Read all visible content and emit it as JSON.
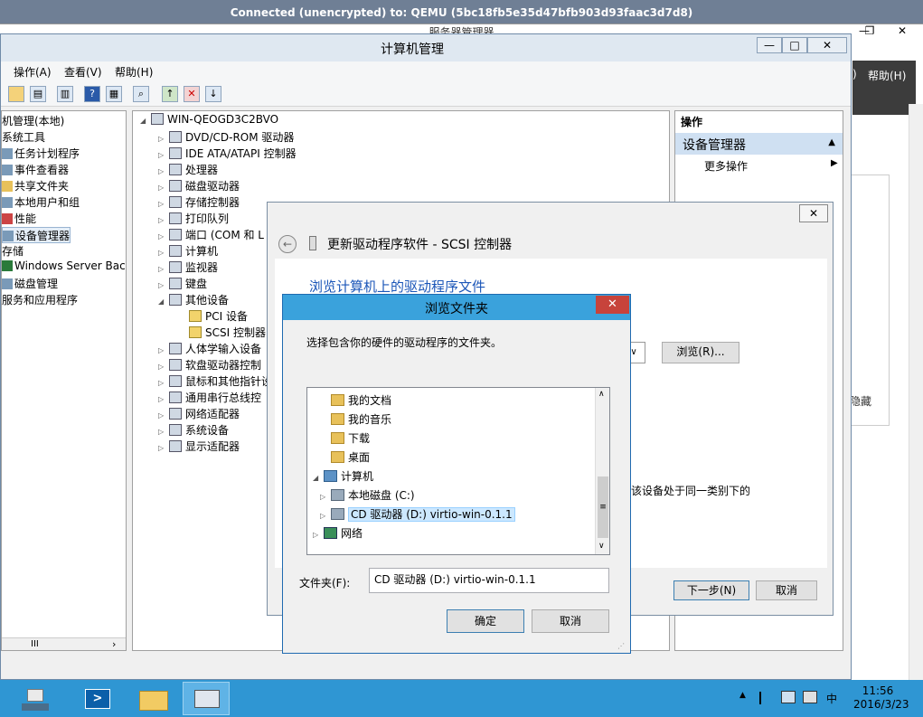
{
  "vnc": {
    "title": "Connected (unencrypted) to: QEMU (5bc18fb5e35d47bfb903d93faac3d7d8)"
  },
  "server_manager": {
    "title": "服务器管理器",
    "help_menu": "帮助(H)",
    "paren": ")",
    "hide_label": "隐藏",
    "controls": {
      "min": "—",
      "max": "❐",
      "close": "✕"
    }
  },
  "computer_mgmt": {
    "title": "计算机管理",
    "controls": {
      "min": "—",
      "max": "□",
      "close": "✕"
    },
    "menu": [
      "操作(A)",
      "查看(V)",
      "帮助(H)"
    ],
    "toolbar_icons": [
      "back-icon",
      "up-folder-icon",
      "properties-icon",
      "export-icon",
      "help-icon",
      "panel-icon",
      "scan-icon",
      "update-driver-icon",
      "disable-device-icon",
      "uninstall-icon"
    ],
    "left_tree": [
      {
        "label": "机管理(本地)",
        "indent": 0
      },
      {
        "label": "系统工具",
        "indent": 0
      },
      {
        "label": "任务计划程序",
        "indent": 1
      },
      {
        "label": "事件查看器",
        "indent": 1
      },
      {
        "label": "共享文件夹",
        "indent": 1
      },
      {
        "label": "本地用户和组",
        "indent": 1
      },
      {
        "label": "性能",
        "indent": 1
      },
      {
        "label": "设备管理器",
        "indent": 1
      },
      {
        "label": "存储",
        "indent": 0
      },
      {
        "label": "Windows Server Back",
        "indent": 1
      },
      {
        "label": "磁盘管理",
        "indent": 1
      },
      {
        "label": "服务和应用程序",
        "indent": 0
      }
    ],
    "left_scroll_label": "III",
    "device_root": "WIN-QEOGD3C2BVO",
    "devices": [
      {
        "label": "DVD/CD-ROM 驱动器",
        "expanded": false,
        "indent": 1
      },
      {
        "label": "IDE ATA/ATAPI 控制器",
        "expanded": false,
        "indent": 1
      },
      {
        "label": "处理器",
        "expanded": false,
        "indent": 1
      },
      {
        "label": "磁盘驱动器",
        "expanded": false,
        "indent": 1
      },
      {
        "label": "存储控制器",
        "expanded": false,
        "indent": 1
      },
      {
        "label": "打印队列",
        "expanded": false,
        "indent": 1
      },
      {
        "label": "端口 (COM 和 L",
        "expanded": false,
        "indent": 1
      },
      {
        "label": "计算机",
        "expanded": false,
        "indent": 1
      },
      {
        "label": "监视器",
        "expanded": false,
        "indent": 1
      },
      {
        "label": "键盘",
        "expanded": false,
        "indent": 1
      },
      {
        "label": "其他设备",
        "expanded": true,
        "indent": 1
      },
      {
        "label": "PCI 设备",
        "expanded": null,
        "indent": 2,
        "warning": true
      },
      {
        "label": "SCSI 控制器",
        "expanded": null,
        "indent": 2,
        "warning": true
      },
      {
        "label": "人体学输入设备",
        "expanded": false,
        "indent": 1
      },
      {
        "label": "软盘驱动器控制",
        "expanded": false,
        "indent": 1
      },
      {
        "label": "鼠标和其他指针设",
        "expanded": false,
        "indent": 1
      },
      {
        "label": "通用串行总线控",
        "expanded": false,
        "indent": 1
      },
      {
        "label": "网络适配器",
        "expanded": false,
        "indent": 1
      },
      {
        "label": "系统设备",
        "expanded": false,
        "indent": 1
      },
      {
        "label": "显示适配器",
        "expanded": false,
        "indent": 1
      }
    ],
    "actions": {
      "header": "操作",
      "section": "设备管理器",
      "more": "更多操作"
    }
  },
  "wizard": {
    "title": "更新驱动程序软件 - SCSI 控制器",
    "heading": "浏览计算机上的驱动程序文件",
    "browse_btn": "浏览(R)...",
    "partial_text": "该设备处于同一类别下的",
    "next_btn": "下一步(N)",
    "cancel_btn": "取消",
    "close": "✕"
  },
  "browse_dialog": {
    "title": "浏览文件夹",
    "close": "✕",
    "instruction": "选择包含你的硬件的驱动程序的文件夹。",
    "tree": [
      {
        "label": "我的文档",
        "icon": "folder-icon",
        "indent": 2,
        "selected": false,
        "arrow": ""
      },
      {
        "label": "我的音乐",
        "icon": "folder-icon",
        "indent": 2,
        "selected": false,
        "arrow": ""
      },
      {
        "label": "下载",
        "icon": "folder-icon",
        "indent": 2,
        "selected": false,
        "arrow": ""
      },
      {
        "label": "桌面",
        "icon": "folder-icon",
        "indent": 2,
        "selected": false,
        "arrow": ""
      },
      {
        "label": "计算机",
        "icon": "computer-icon",
        "indent": 1,
        "selected": false,
        "arrow": "◢"
      },
      {
        "label": "本地磁盘 (C:)",
        "icon": "disk-icon",
        "indent": 2,
        "selected": false,
        "arrow": "▷"
      },
      {
        "label": "CD 驱动器 (D:) virtio-win-0.1.1",
        "icon": "cd-drive-icon",
        "indent": 2,
        "selected": true,
        "arrow": "▷"
      },
      {
        "label": "网络",
        "icon": "network-icon",
        "indent": 1,
        "selected": false,
        "arrow": "▷"
      }
    ],
    "folder_label": "文件夹(F):",
    "folder_value": "CD 驱动器 (D:) virtio-win-0.1.1",
    "ok": "确定",
    "cancel": "取消"
  },
  "taskbar": {
    "apps": [
      "server-manager-icon",
      "powershell-icon",
      "file-explorer-icon",
      "computer-management-icon"
    ],
    "tray_expand": "▲",
    "ime": "中",
    "time": "11:56",
    "date": "2016/3/23"
  }
}
